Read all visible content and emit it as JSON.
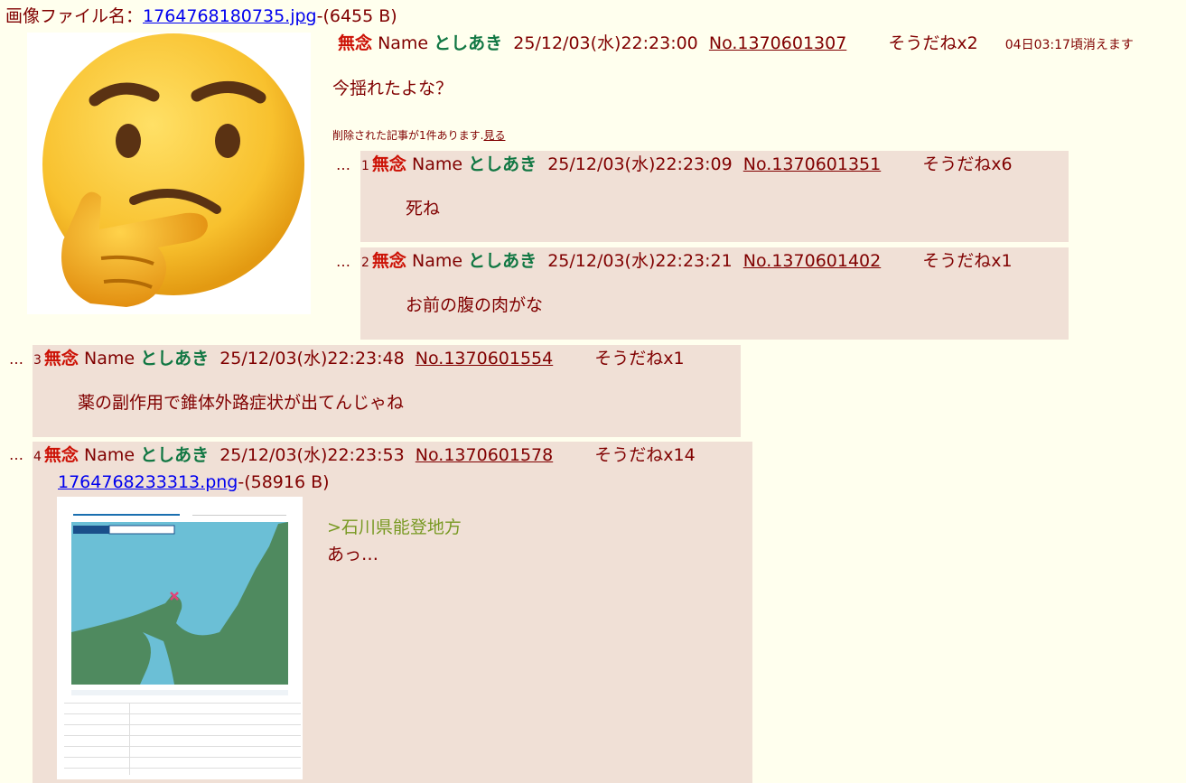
{
  "op": {
    "file_label": "画像ファイル名：",
    "file_name": "1764768180735.jpg",
    "file_size": "-(6455 B)",
    "subject": "無念",
    "name_label": "Name",
    "name": "としあき",
    "datetime": "25/12/03(水)22:23:00",
    "number": "No.1370601307",
    "sodane": "そうだねx2",
    "expire": "04日03:17頃消えます",
    "body": "今揺れたよな？",
    "deleted_notice": "削除された記事が1件あります.",
    "deleted_link": "見る"
  },
  "replies": [
    {
      "dots": "…",
      "index": "1",
      "subject": "無念",
      "name_label": "Name",
      "name": "としあき",
      "datetime": "25/12/03(水)22:23:09",
      "number": "No.1370601351",
      "sodane": "そうだねx6",
      "body": "死ね"
    },
    {
      "dots": "…",
      "index": "2",
      "subject": "無念",
      "name_label": "Name",
      "name": "としあき",
      "datetime": "25/12/03(水)22:23:21",
      "number": "No.1370601402",
      "sodane": "そうだねx1",
      "body": "お前の腹の肉がな"
    },
    {
      "dots": "…",
      "index": "3",
      "subject": "無念",
      "name_label": "Name",
      "name": "としあき",
      "datetime": "25/12/03(水)22:23:48",
      "number": "No.1370601554",
      "sodane": "そうだねx1",
      "body": "薬の副作用で錐体外路症状が出てんじゃね"
    },
    {
      "dots": "…",
      "index": "4",
      "subject": "無念",
      "name_label": "Name",
      "name": "としあき",
      "datetime": "25/12/03(水)22:23:53",
      "number": "No.1370601578",
      "sodane": "そうだねx14",
      "file_name": "1764768233313.png",
      "file_size": "-(58916 B)",
      "quote": ">石川県能登地方",
      "body": "あっ…"
    }
  ],
  "images": {
    "op_thumbnail": "thinking-face-emoji",
    "reply4_thumbnail": "earthquake-map"
  },
  "colors": {
    "background": "#ffffee",
    "reply_background": "#f0e0d6",
    "text": "#800000",
    "subject": "#cc1105",
    "name": "#117743",
    "quote": "#789922",
    "file_link": "#0000ee"
  }
}
